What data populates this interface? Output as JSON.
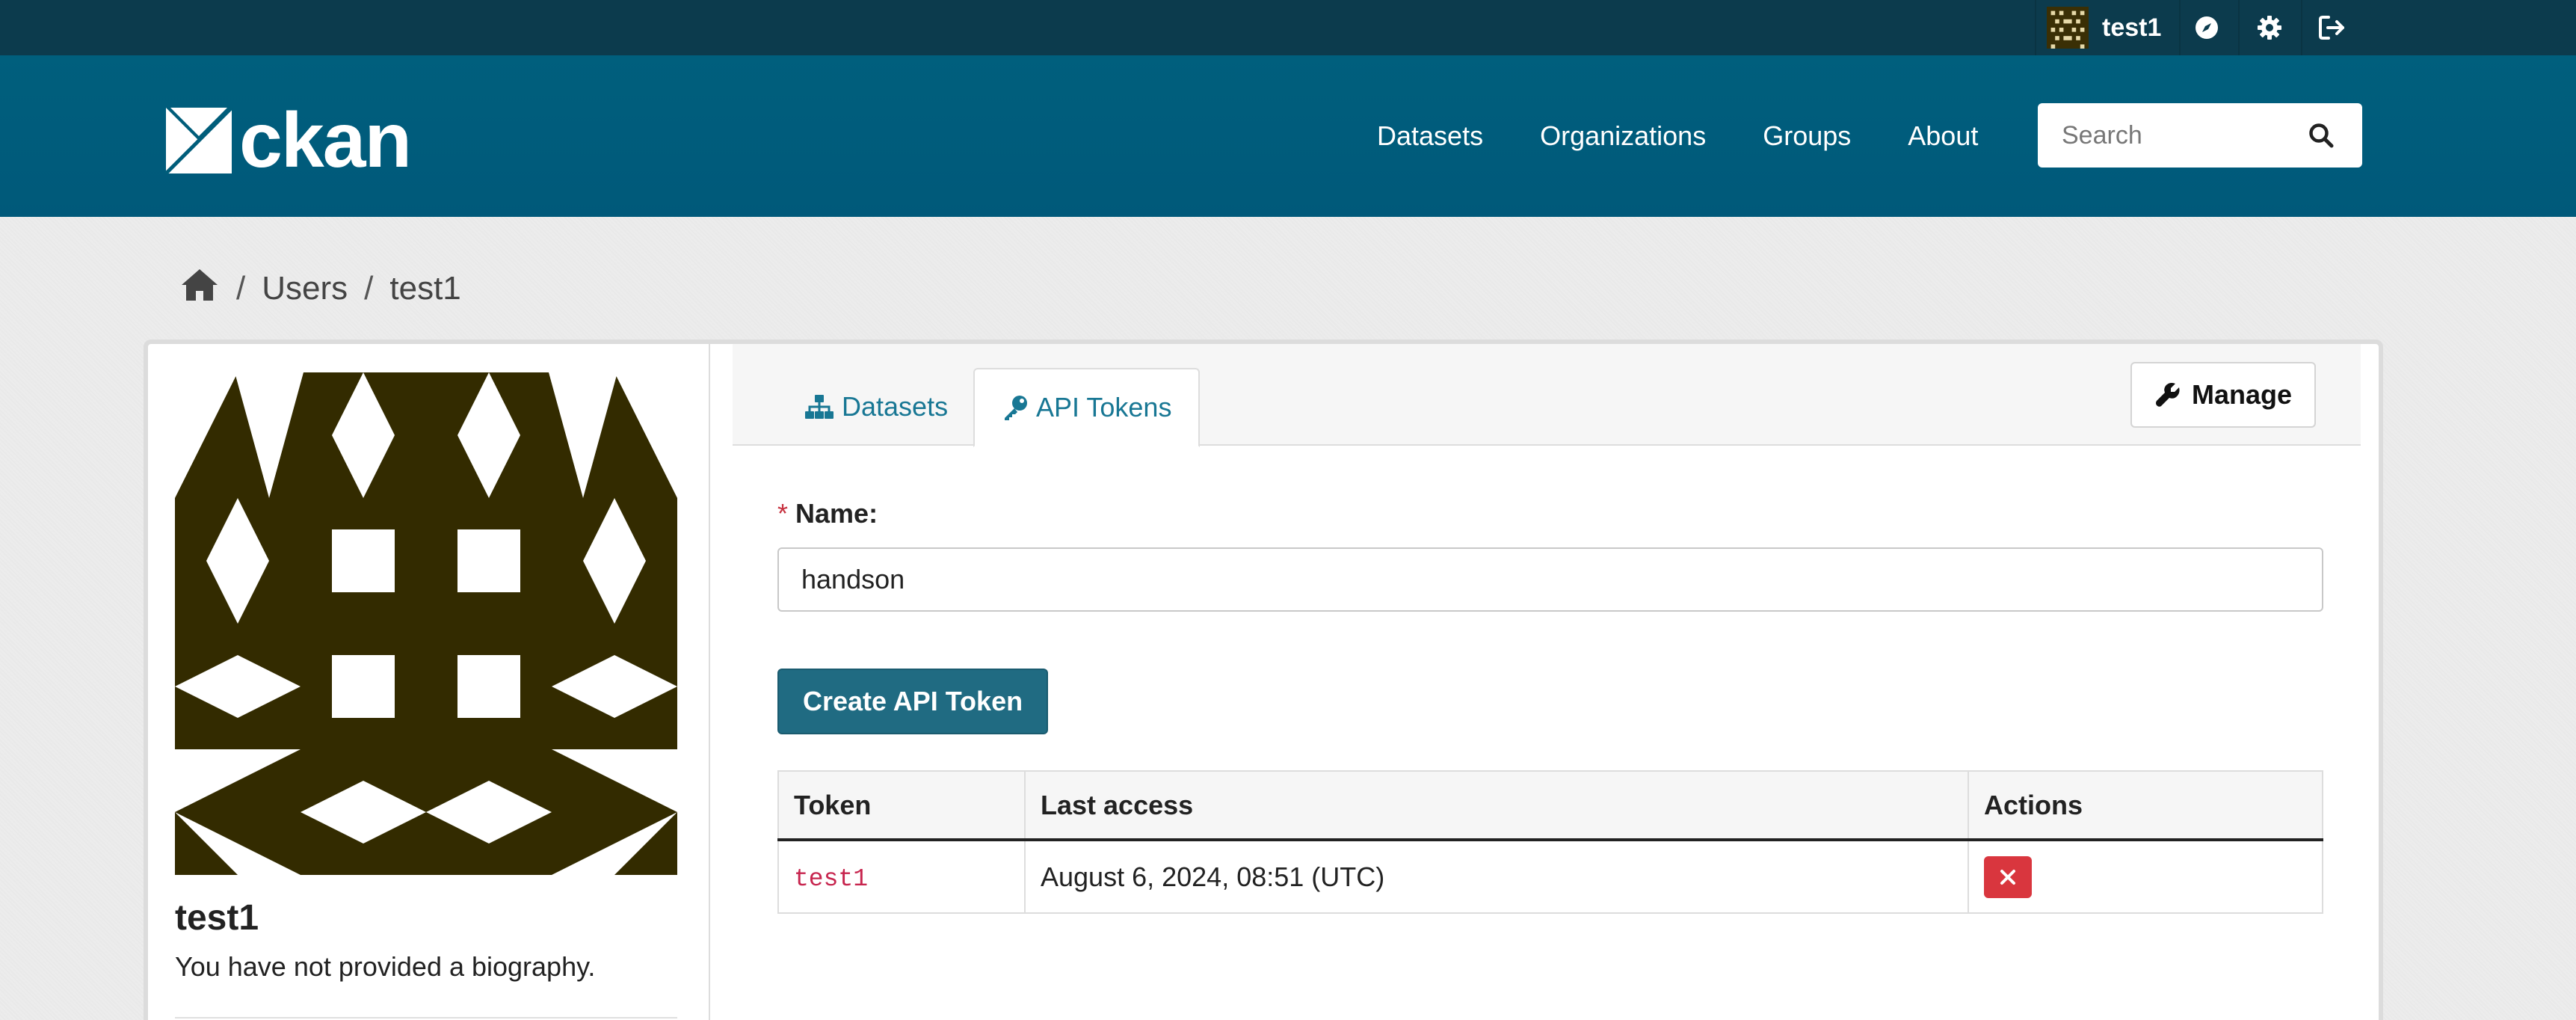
{
  "account": {
    "username": "test1",
    "icons": [
      "dashboard-icon",
      "gear-icon",
      "sign-out-icon"
    ]
  },
  "header": {
    "logo_text": "ckan",
    "nav": [
      "Datasets",
      "Organizations",
      "Groups",
      "About"
    ],
    "search_placeholder": "Search"
  },
  "breadcrumb": {
    "home_icon": "home-icon",
    "items": [
      "Users",
      "test1"
    ],
    "separator": "/"
  },
  "profile": {
    "name": "test1",
    "bio": "You have not provided a biography."
  },
  "tabs": [
    {
      "label": "Datasets",
      "icon": "sitemap-icon",
      "active": false
    },
    {
      "label": "API Tokens",
      "icon": "key-icon",
      "active": true
    }
  ],
  "manage_button": {
    "label": "Manage",
    "icon": "wrench-icon"
  },
  "form": {
    "name_label": "Name:",
    "required_marker": "*",
    "name_value": "handson",
    "submit_label": "Create API Token"
  },
  "tokens_table": {
    "headers": [
      "Token",
      "Last access",
      "Actions"
    ],
    "rows": [
      {
        "token": "test1",
        "last_access": "August 6, 2024, 08:51 (UTC)",
        "action_icon": "close-icon"
      }
    ]
  },
  "colors": {
    "account_bar": "#0c3b4d",
    "masthead": "#005d7a",
    "link": "#187794",
    "primary_button": "#206b82",
    "danger": "#d9363e",
    "identicon": "#332b00"
  }
}
